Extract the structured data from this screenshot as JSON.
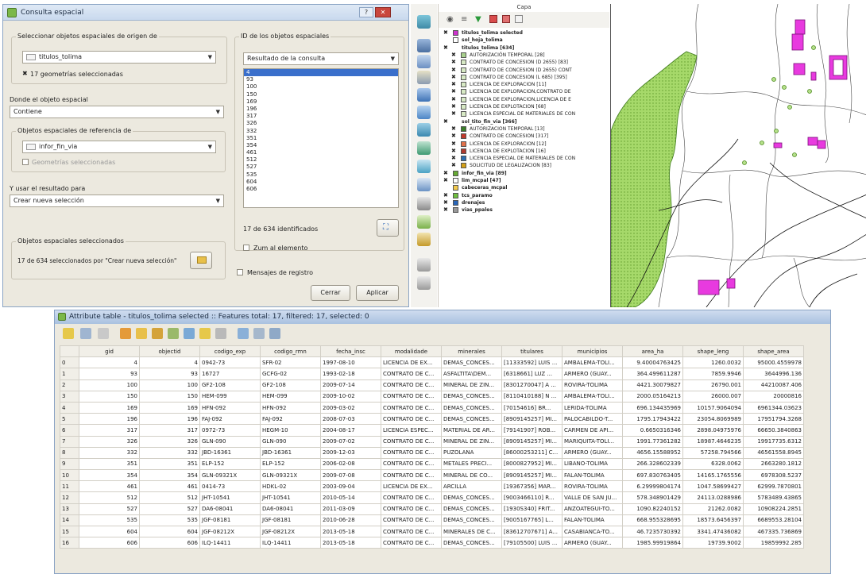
{
  "dialog": {
    "title": "Consulta espacial",
    "source_group_label": "Seleccionar objetos espaciales de origen de",
    "source_layer": "titulos_tolima",
    "selected_geoms": "17 geometrías seleccionadas",
    "where_label": "Donde el objeto espacial",
    "operation": "Contiene",
    "ref_group_label": "Objetos espaciales de referencia de",
    "ref_layer": "infor_fin_via",
    "ref_checkbox_label": "Geometrías seleccionadas",
    "use_result_label": "Y usar el resultado para",
    "use_result_value": "Crear nueva selección",
    "selected_group_label": "Objetos espaciales seleccionados",
    "selected_summary": "17 de 634 seleccionados por \"Crear nueva selección\"",
    "ids_group_label": "ID de los objetos espaciales",
    "ids_combo": "Resultado de la consulta",
    "ids": [
      "4",
      "93",
      "100",
      "150",
      "169",
      "196",
      "317",
      "326",
      "332",
      "351",
      "354",
      "461",
      "512",
      "527",
      "535",
      "604",
      "606"
    ],
    "identified": "17 de 634 identificados",
    "zoom_label": "Zum al elemento",
    "log_label": "Mensajes de registro",
    "close_button": "Cerrar",
    "apply_button": "Aplicar"
  },
  "layers_panel": {
    "header": "Capa",
    "items": [
      {
        "name": "titulos_tolima selected",
        "bold": true,
        "indent": 0,
        "swatch": "#cc33cc",
        "x": true
      },
      {
        "name": "sol_hoja_tolima",
        "bold": true,
        "indent": 0,
        "swatch": "#ffffff",
        "x": false
      },
      {
        "name": "titulos_tolima [634]",
        "bold": true,
        "indent": 0,
        "swatch": "",
        "x": true
      },
      {
        "name": "AUTORIZACIÓN TEMPORAL [28]",
        "bold": false,
        "indent": 1,
        "swatch": "#a8d08d",
        "x": true
      },
      {
        "name": "CONTRATO DE CONCESION (D 2655) [83]",
        "bold": false,
        "indent": 1,
        "swatch": "#d7e9c4",
        "x": true
      },
      {
        "name": "CONTRATO DE CONCESION (D 2655) CONT",
        "bold": false,
        "indent": 1,
        "swatch": "#d7e9c4",
        "x": true
      },
      {
        "name": "CONTRATO DE CONCESION (L 685) [395]",
        "bold": false,
        "indent": 1,
        "swatch": "#d7e9c4",
        "x": true
      },
      {
        "name": "LICENCIA DE EXPLORACION [11]",
        "bold": false,
        "indent": 1,
        "swatch": "#d7e9c4",
        "x": true
      },
      {
        "name": "LICENCIA DE EXPLORACION,CONTRATO DE",
        "bold": false,
        "indent": 1,
        "swatch": "#d7e9c4",
        "x": true
      },
      {
        "name": "LICENCIA DE EXPLORACION,LICENCIA DE E",
        "bold": false,
        "indent": 1,
        "swatch": "#d7e9c4",
        "x": true
      },
      {
        "name": "LICENCIA DE EXPLOTACION [68]",
        "bold": false,
        "indent": 1,
        "swatch": "#d7e9c4",
        "x": true
      },
      {
        "name": "LICENCIA ESPECIAL DE MATERIALES DE CON",
        "bold": false,
        "indent": 1,
        "swatch": "#d7e9c4",
        "x": true
      },
      {
        "name": "sol_tito_fin_via [366]",
        "bold": true,
        "indent": 0,
        "swatch": "",
        "x": true
      },
      {
        "name": "AUTORIZACION TEMPORAL [13]",
        "bold": false,
        "indent": 1,
        "swatch": "#3a7d2a",
        "x": true
      },
      {
        "name": "CONTRATO DE CONCESION [317]",
        "bold": false,
        "indent": 1,
        "swatch": "#c0392b",
        "x": true
      },
      {
        "name": "LICENCIA DE EXPLORACION [12]",
        "bold": false,
        "indent": 1,
        "swatch": "#e0704a",
        "x": true
      },
      {
        "name": "LICENCIA DE EXPLOTACION [16]",
        "bold": false,
        "indent": 1,
        "swatch": "#b03a2e",
        "x": true
      },
      {
        "name": "LICENCIA ESPECIAL DE MATERIALES DE CON",
        "bold": false,
        "indent": 1,
        "swatch": "#2e6fb0",
        "x": true
      },
      {
        "name": "SOLICITUD DE LEGALIZACION [83]",
        "bold": false,
        "indent": 1,
        "swatch": "#d4a017",
        "x": true
      },
      {
        "name": "infor_fin_via [89]",
        "bold": true,
        "indent": 0,
        "swatch": "#66aa33",
        "x": true
      },
      {
        "name": "lim_mcpal [47]",
        "bold": true,
        "indent": 0,
        "swatch": "#ffffff",
        "x": true
      },
      {
        "name": "cabeceras_mcpal",
        "bold": true,
        "indent": 0,
        "swatch": "#f2c94c",
        "x": false
      },
      {
        "name": "tcs_paramo",
        "bold": true,
        "indent": 0,
        "swatch": "#6fbf3f",
        "x": true
      },
      {
        "name": "drenajes",
        "bold": true,
        "indent": 0,
        "swatch": "#2a66b8",
        "x": true
      },
      {
        "name": "vias_ppales",
        "bold": true,
        "indent": 0,
        "swatch": "#999999",
        "x": true
      }
    ]
  },
  "attribute_table": {
    "title": "Attribute table - titulos_tolima selected :: Features total: 17, filtered: 17, selected: 0",
    "columns": [
      "gid",
      "objectid",
      "codigo_exp",
      "codigo_rmn",
      "fecha_insc",
      "modalidade",
      "minerales",
      "titulares",
      "municipios",
      "area_ha",
      "shape_leng",
      "shape_area"
    ],
    "rows": [
      [
        "0",
        "4",
        "4",
        "0942-73",
        "SFR-02",
        "1997-08-10",
        "LICENCIA DE EX...",
        "DEMAS_CONCES...",
        "[11333592] LUIS ...",
        "AMBALEMA-TOLI...",
        "9.40004763425",
        "1260.0032",
        "95000.4559978"
      ],
      [
        "1",
        "93",
        "93",
        "16727",
        "GCFG-02",
        "1993-02-18",
        "CONTRATO DE C...",
        "ASFALTITA\\DEM...",
        "[6318661] LUZ ...",
        "ARMERO (GUAY...",
        "364.499611287",
        "7859.9946",
        "3644996.136"
      ],
      [
        "2",
        "100",
        "100",
        "GF2-108",
        "GF2-108",
        "2009-07-14",
        "CONTRATO DE C...",
        "MINERAL DE ZIN...",
        "[8301270047] A ...",
        "ROVIRA-TOLIMA",
        "4421.30079827",
        "26790.001",
        "44210087.406"
      ],
      [
        "3",
        "150",
        "150",
        "HEM-099",
        "HEM-099",
        "2009-10-02",
        "CONTRATO DE C...",
        "DEMAS_CONCES...",
        "[8110410188] N ...",
        "AMBALEMA-TOLI...",
        "2000.05164213",
        "26000.007",
        "20000816"
      ],
      [
        "4",
        "169",
        "169",
        "HFN-092",
        "HFN-092",
        "2009-03-02",
        "CONTRATO DE C...",
        "DEMAS_CONCES...",
        "[70154616] BR...",
        "LERIDA-TOLIMA",
        "696.134435969",
        "10157.9064094",
        "6961344.03623"
      ],
      [
        "5",
        "196",
        "196",
        "FAJ-092",
        "FAJ-092",
        "2008-07-03",
        "CONTRATO DE C...",
        "DEMAS_CONCES...",
        "[8909145257] MI...",
        "PALOCABILDO-T...",
        "1795.17943422",
        "23054.8069989",
        "17951794.3268"
      ],
      [
        "6",
        "317",
        "317",
        "0972-73",
        "HEGM-10",
        "2004-08-17",
        "LICENCIA ESPEC...",
        "MATERIAL DE AR...",
        "[79141907] ROB...",
        "CARMEN DE API...",
        "0.6650316346",
        "2898.04975976",
        "66650.3840863"
      ],
      [
        "7",
        "326",
        "326",
        "GLN-090",
        "GLN-090",
        "2009-07-02",
        "CONTRATO DE C...",
        "MINERAL DE ZIN...",
        "[8909145257] MI...",
        "MARIQUITA-TOLI...",
        "1991.77361282",
        "18987.4646235",
        "19917735.6312"
      ],
      [
        "8",
        "332",
        "332",
        "JBD-16361",
        "JBD-16361",
        "2009-12-03",
        "CONTRATO DE C...",
        "PUZOLANA",
        "[86000253211] C...",
        "ARMERO (GUAY...",
        "4656.15588952",
        "57258.794566",
        "46561558.8945"
      ],
      [
        "9",
        "351",
        "351",
        "ELP-152",
        "ELP-152",
        "2006-02-08",
        "CONTRATO DE C...",
        "METALES PRECI...",
        "[8000827952] MI...",
        "LIBANO-TOLIMA",
        "266.328602339",
        "6328.0062",
        "2663280.1812"
      ],
      [
        "10",
        "354",
        "354",
        "GLN-09321X",
        "GLN-09321X",
        "2009-07-08",
        "CONTRATO DE C...",
        "MINERAL DE CO...",
        "[8909145257] MI...",
        "FALAN-TOLIMA",
        "697.830763405",
        "14165.1765556",
        "6978308.5237"
      ],
      [
        "11",
        "461",
        "461",
        "0414-73",
        "HDKL-02",
        "2003-09-04",
        "LICENCIA DE EX...",
        "ARCILLA",
        "[19367356] MAR...",
        "ROVIRA-TOLIMA",
        "6.29999804174",
        "1047.58699427",
        "62999.7870801"
      ],
      [
        "12",
        "512",
        "512",
        "JHT-10541",
        "JHT-10541",
        "2010-05-14",
        "CONTRATO DE C...",
        "DEMAS_CONCES...",
        "[9003466110] R...",
        "VALLE DE SAN JU...",
        "578.348901429",
        "24113.0288986",
        "5783489.43865"
      ],
      [
        "13",
        "527",
        "527",
        "DA6-08041",
        "DA6-08041",
        "2011-03-09",
        "CONTRATO DE C...",
        "DEMAS_CONCES...",
        "[1930S340] FRIT...",
        "ANZOATEGUI-TO...",
        "1090.82240152",
        "21262.0082",
        "10908224.2851"
      ],
      [
        "14",
        "535",
        "535",
        "JGF-08181",
        "JGF-08181",
        "2010-06-28",
        "CONTRATO DE C...",
        "DEMAS_CONCES...",
        "[9005167765] L...",
        "FALAN-TOLIMA",
        "668.955328695",
        "18573.6456397",
        "6689553.28104"
      ],
      [
        "15",
        "604",
        "604",
        "JGF-08212X",
        "JGF-08212X",
        "2013-05-18",
        "CONTRATO DE C...",
        "MINERALES DE C...",
        "[83612707671] A...",
        "CASABIANCA-TO...",
        "46.7235730392",
        "3341.47436082",
        "467335.736869"
      ],
      [
        "16",
        "606",
        "606",
        "ILQ-14411",
        "ILQ-14411",
        "2013-05-18",
        "CONTRATO DE C...",
        "DEMAS_CONCES...",
        "[79105500] LUIS ...",
        "ARMERO (GUAY...",
        "1985.99919864",
        "19739.9002",
        "19859992.285"
      ]
    ]
  },
  "colors": {
    "selection_blue": "#3a6fcb",
    "selected_feature": "#e83adf",
    "paramo_green": "#a6d96a"
  }
}
